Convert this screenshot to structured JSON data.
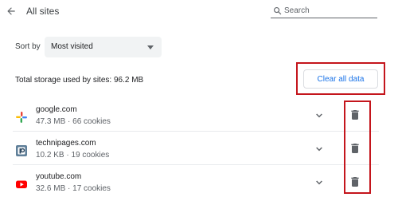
{
  "header": {
    "title": "All sites",
    "search_placeholder": "Search",
    "back_icon": "arrow-back-icon",
    "search_icon": "search-icon"
  },
  "sort": {
    "label": "Sort by",
    "selected": "Most visited"
  },
  "storage": {
    "text": "Total storage used by sites: 96.2 MB",
    "clear_button": "Clear all data"
  },
  "sites": [
    {
      "name": "google.com",
      "meta": "47.3 MB · 66 cookies",
      "favicon": "google-favicon-icon"
    },
    {
      "name": "technipages.com",
      "meta": "10.2 KB · 19 cookies",
      "favicon": "technipages-favicon-icon"
    },
    {
      "name": "youtube.com",
      "meta": "32.6 MB · 17 cookies",
      "favicon": "youtube-favicon-icon"
    }
  ],
  "colors": {
    "accent": "#1a73e8",
    "highlight": "#c4151c",
    "icon": "#5f6368"
  }
}
